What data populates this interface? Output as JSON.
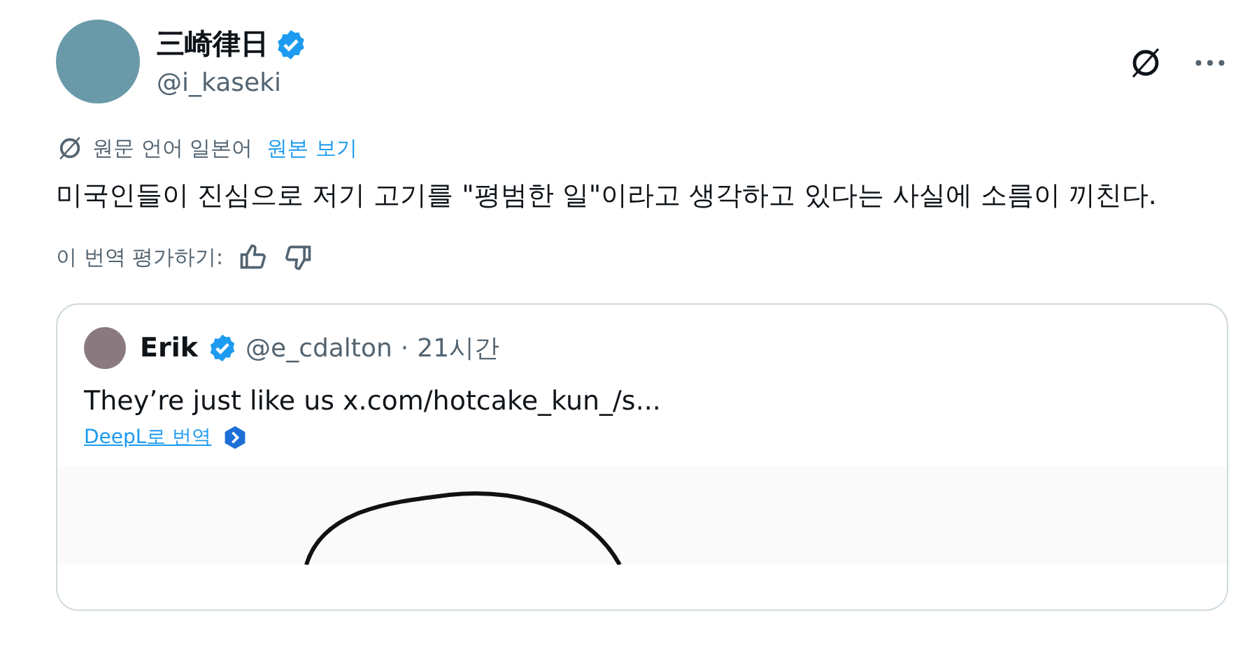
{
  "author": {
    "name": "三崎律日",
    "handle": "@i_kaseki",
    "verified": true
  },
  "translation": {
    "source_label": "원문 언어 일본어",
    "link": "원본 보기"
  },
  "body": "미국인들이 진심으로 저기 고기를 \"평범한 일\"이라고 생각하고 있다는 사실에 소름이 끼친다.",
  "rating": {
    "label": "이 번역 평가하기:"
  },
  "quote": {
    "name": "Erik",
    "verified": true,
    "handle": "@e_cdalton",
    "separator": "·",
    "time": "21시간",
    "text": "They’re just like us  x.com/hotcake_kun_/s...",
    "translate_link": "DeepL로 번역"
  }
}
